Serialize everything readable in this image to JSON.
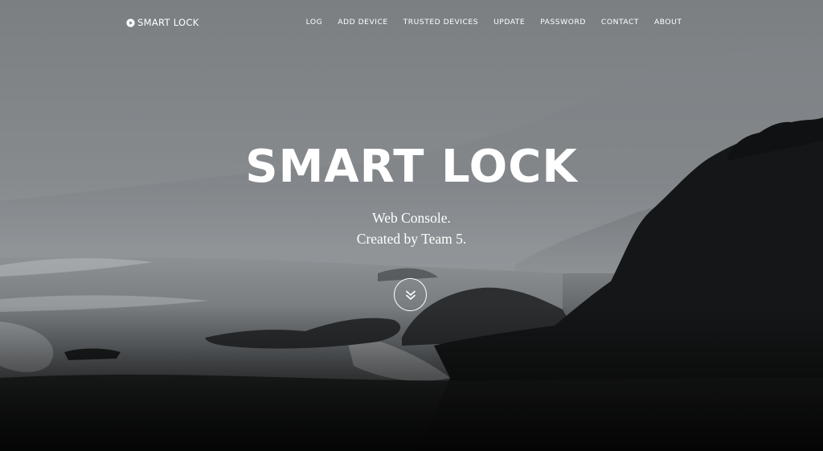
{
  "brand": {
    "name": "SMART LOCK",
    "icon": "play-circle-icon"
  },
  "nav": {
    "items": [
      {
        "label": "LOG"
      },
      {
        "label": "ADD DEVICE"
      },
      {
        "label": "TRUSTED DEVICES"
      },
      {
        "label": "UPDATE"
      },
      {
        "label": "PASSWORD"
      },
      {
        "label": "CONTACT"
      },
      {
        "label": "ABOUT"
      }
    ]
  },
  "hero": {
    "title": "SMART LOCK",
    "subtitle_line1": "Web Console.",
    "subtitle_line2": "Created by Team 5.",
    "scroll_icon": "double-chevron-down-icon"
  },
  "colors": {
    "text": "#ffffff",
    "sky": "#85898c",
    "rock": "#151617"
  }
}
